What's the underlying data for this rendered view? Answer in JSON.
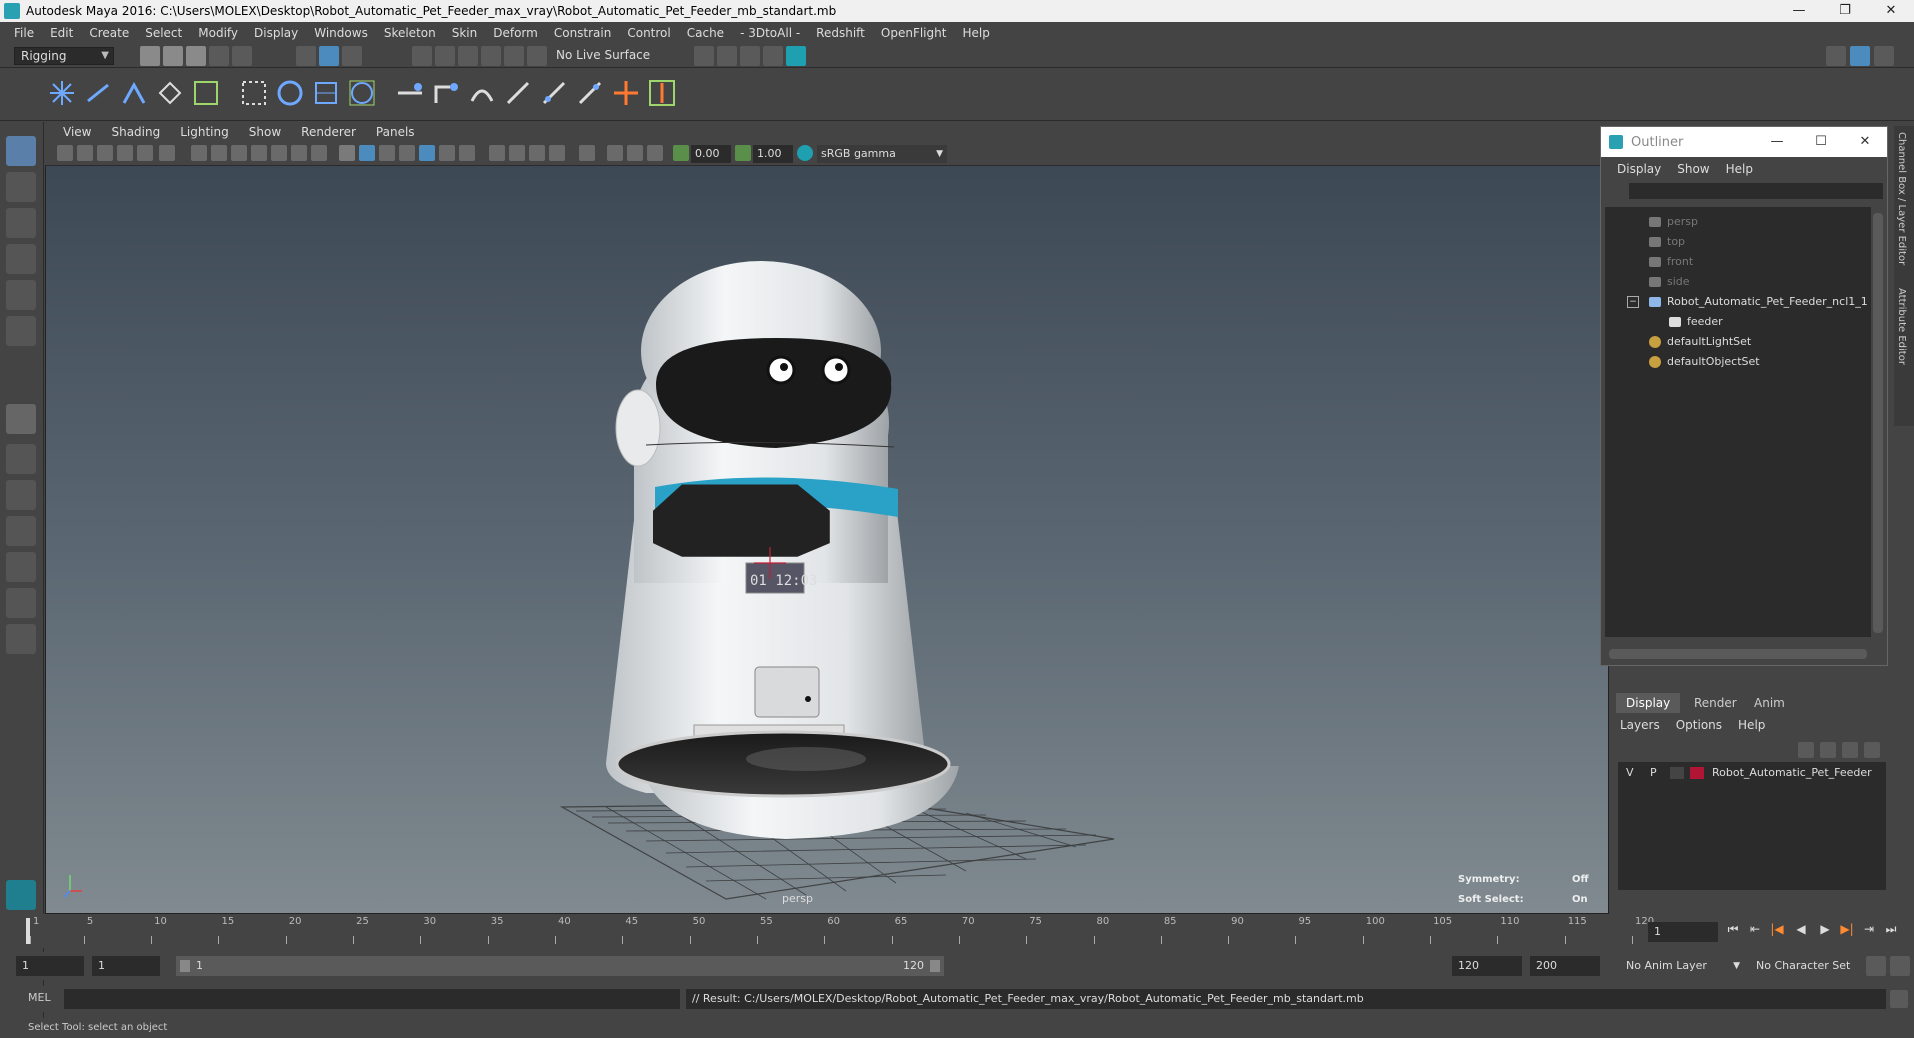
{
  "window": {
    "title": "Autodesk Maya 2016: C:\\Users\\MOLEX\\Desktop\\Robot_Automatic_Pet_Feeder_max_vray\\Robot_Automatic_Pet_Feeder_mb_standart.mb",
    "minimize": "—",
    "restore": "❐",
    "close": "✕"
  },
  "menubar": [
    "File",
    "Edit",
    "Create",
    "Select",
    "Modify",
    "Display",
    "Windows",
    "Skeleton",
    "Skin",
    "Deform",
    "Constrain",
    "Control",
    "Cache",
    "- 3DtoAll -",
    "Redshift",
    "OpenFlight",
    "Help"
  ],
  "statusline": {
    "menuset": "Rigging",
    "live_surface": "No Live Surface"
  },
  "panel": {
    "menus": [
      "View",
      "Shading",
      "Lighting",
      "Show",
      "Renderer",
      "Panels"
    ],
    "exposure": "0.00",
    "gamma": "1.00",
    "colorspace": "sRGB gamma",
    "camera": "persp",
    "hud": {
      "symmetry_label": "Symmetry:",
      "symmetry_value": "Off",
      "softselect_label": "Soft Select:",
      "softselect_value": "On"
    }
  },
  "outliner": {
    "title": "Outliner",
    "menus": [
      "Display",
      "Show",
      "Help"
    ],
    "items": [
      {
        "label": "persp",
        "type": "camera",
        "dim": true
      },
      {
        "label": "top",
        "type": "camera",
        "dim": true
      },
      {
        "label": "front",
        "type": "camera",
        "dim": true
      },
      {
        "label": "side",
        "type": "camera",
        "dim": true
      },
      {
        "label": "Robot_Automatic_Pet_Feeder_ncl1_1",
        "type": "locator",
        "dim": false
      },
      {
        "label": "feeder",
        "type": "mesh",
        "dim": false
      },
      {
        "label": "defaultLightSet",
        "type": "set",
        "dim": false
      },
      {
        "label": "defaultObjectSet",
        "type": "set",
        "dim": false
      }
    ]
  },
  "layer_editor": {
    "tabs": [
      "Display",
      "Render",
      "Anim"
    ],
    "menus": [
      "Layers",
      "Options",
      "Help"
    ],
    "layer": {
      "v": "V",
      "p": "P",
      "name": "Robot_Automatic_Pet_Feeder",
      "color": "#b01535"
    }
  },
  "side_tabs": [
    "Channel Box / Layer Editor",
    "Attribute Editor"
  ],
  "timeslider": {
    "ticks": [
      "1",
      "5",
      "10",
      "15",
      "20",
      "25",
      "30",
      "35",
      "40",
      "45",
      "50",
      "55",
      "60",
      "65",
      "70",
      "75",
      "80",
      "85",
      "90",
      "95",
      "100",
      "105",
      "110",
      "115",
      "120"
    ],
    "current_frame": "1"
  },
  "range": {
    "start": "1",
    "playback_start": "1",
    "range_start_label": "1",
    "range_end_label": "120",
    "playback_end": "120",
    "end": "200",
    "anim_layer": "No Anim Layer",
    "character_set": "No Character Set"
  },
  "cmdline": {
    "lang": "MEL",
    "result": "// Result: C:/Users/MOLEX/Desktop/Robot_Automatic_Pet_Feeder_max_vray/Robot_Automatic_Pet_Feeder_mb_standart.mb"
  },
  "helpline": "Select Tool: select an object",
  "feeder_display": "01 12:03"
}
